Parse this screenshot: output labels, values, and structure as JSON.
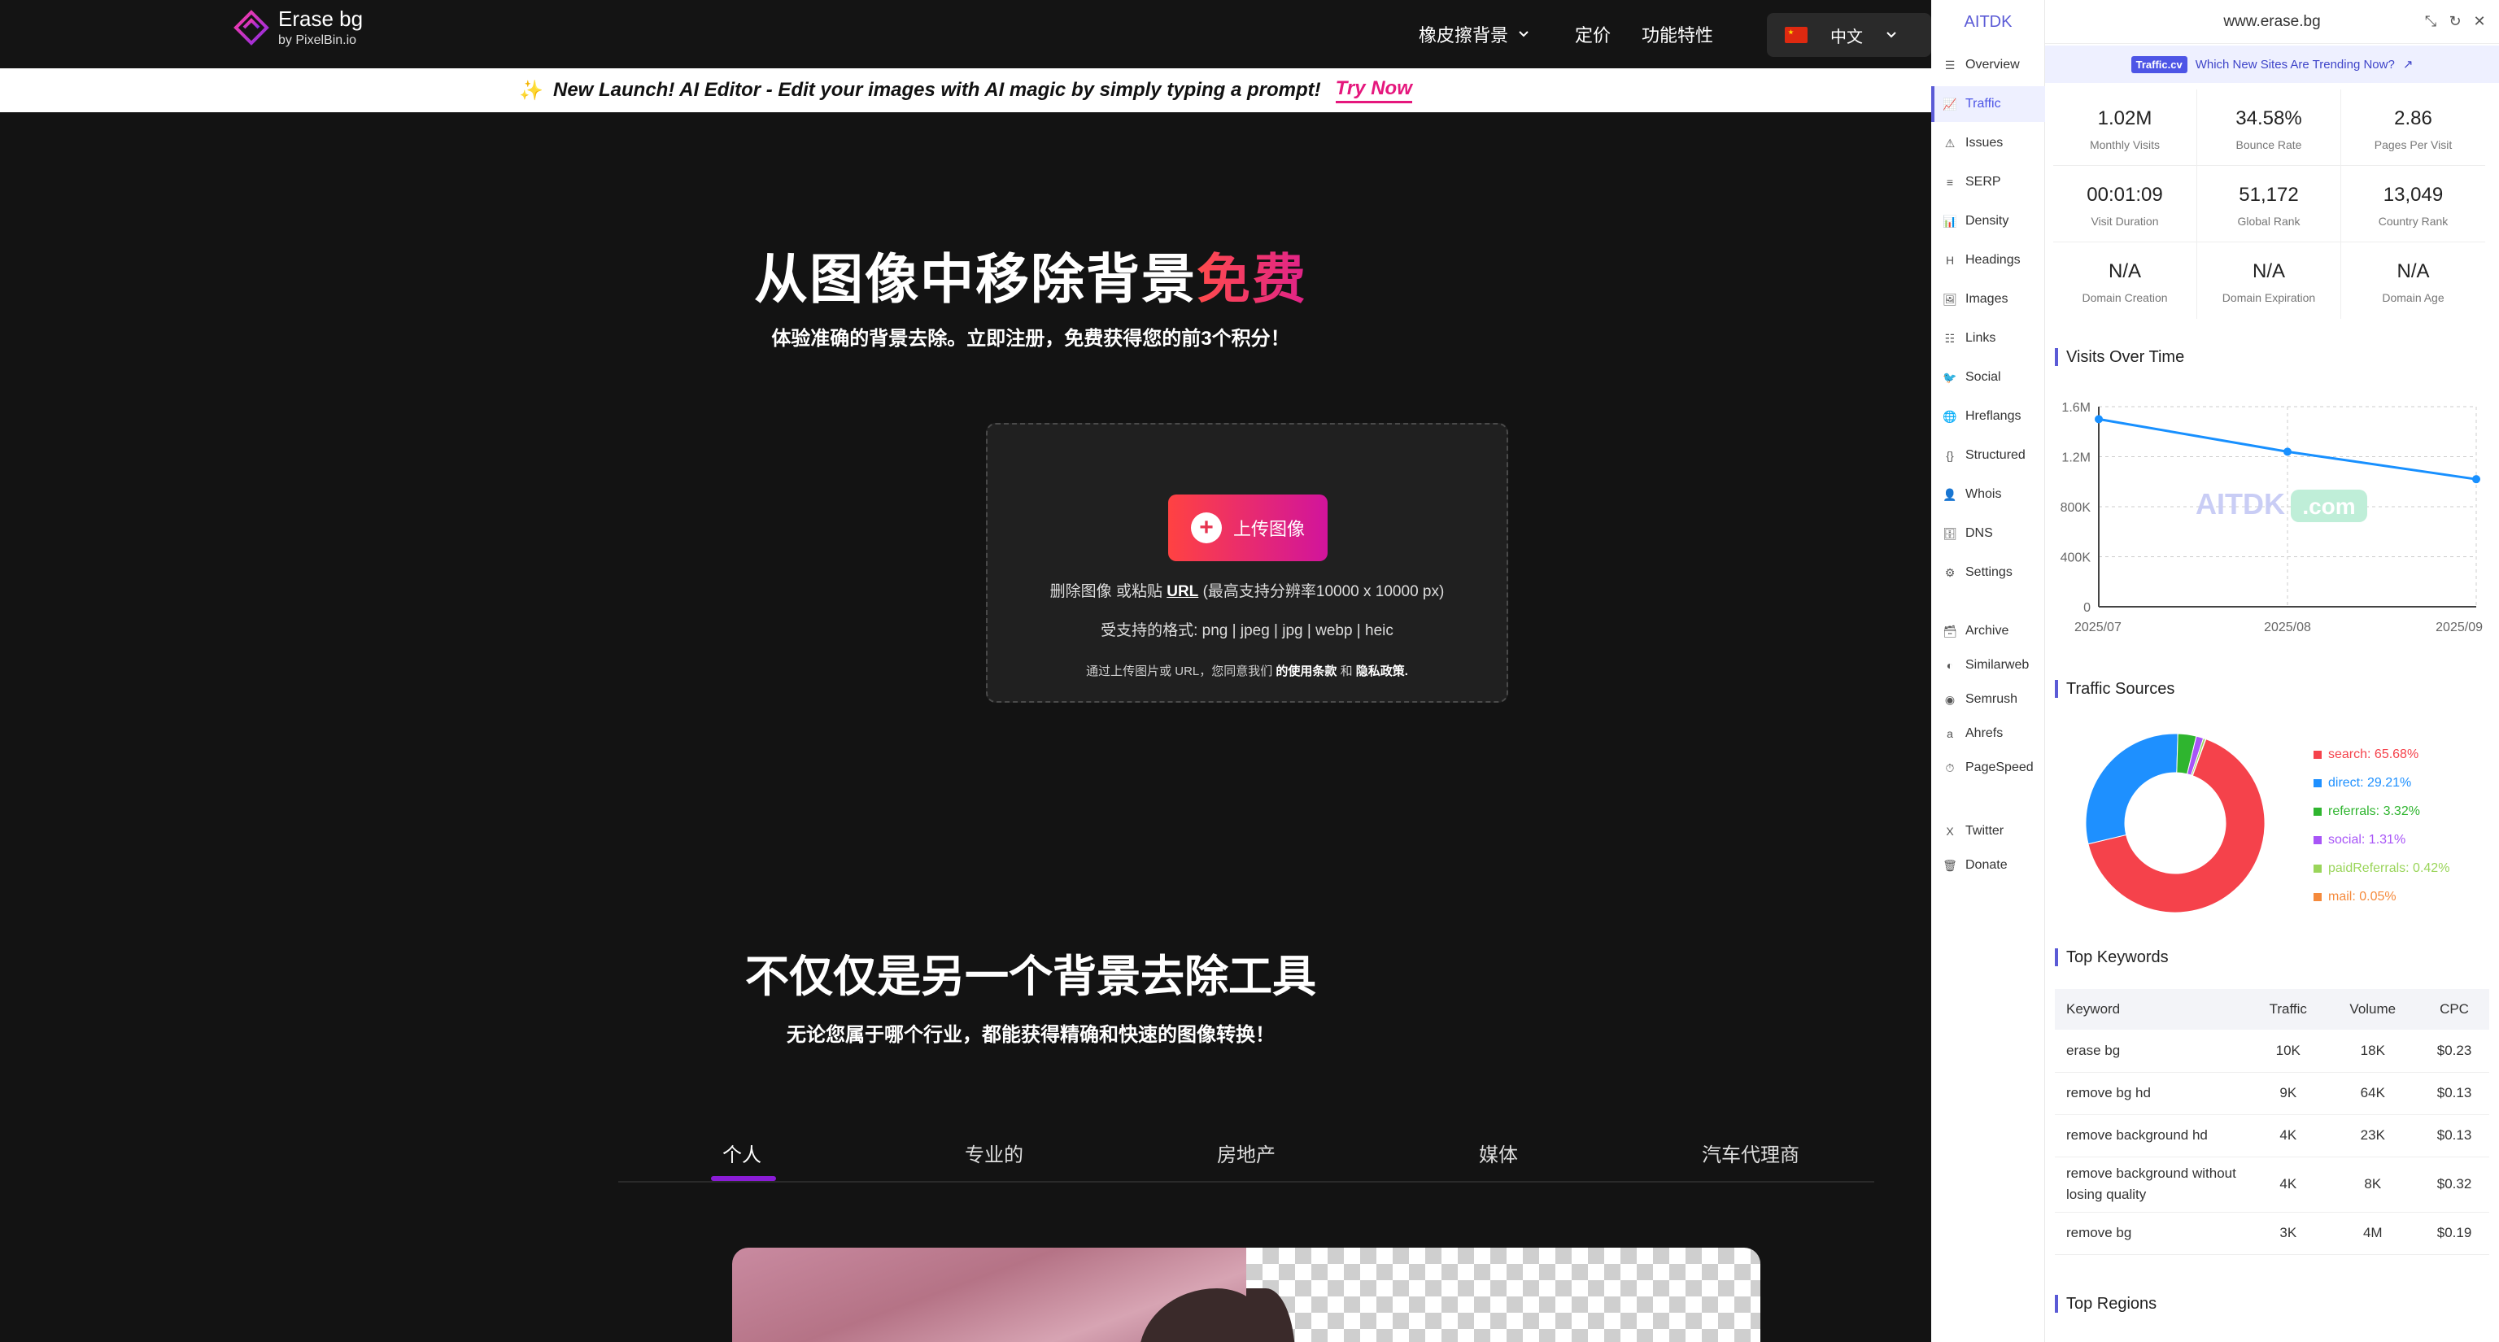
{
  "site": {
    "logo_title": "Erase bg",
    "logo_sub": "by PixelBin.io",
    "nav": [
      "橡皮擦背景",
      "定价",
      "功能特性"
    ],
    "language": "中文",
    "banner_text": "New Launch! AI Editor - Edit your images with AI magic by simply typing a prompt!",
    "banner_link": "Try Now",
    "hero_title_main": "从图像中移除背景",
    "hero_title_accent": "免费",
    "hero_subtitle": "体验准确的背景去除。立即注册，免费获得您的前3个积分！",
    "upload_button": "上传图像",
    "upload_line1_pre": "删除图像 或粘贴 ",
    "upload_line1_url": "URL",
    "upload_line1_post": " (最高支持分辨率10000 x 10000 px)",
    "upload_line2": "受支持的格式: png | jpeg | jpg | webp | heic",
    "upload_line3_pre": "通过上传图片或 URL，您同意我们 ",
    "upload_line3_terms": "的使用条款",
    "upload_line3_and": " 和 ",
    "upload_line3_privacy": "隐私政策.",
    "section_title": "不仅仅是另一个背景去除工具",
    "section_subtitle": "无论您属于哪个行业，都能获得精确和快速的图像转换！",
    "tabs": [
      "个人",
      "专业的",
      "房地产",
      "媒体",
      "汽车代理商"
    ]
  },
  "ext": {
    "brand": "AITDK",
    "domain": "www.erase.bg",
    "promo_tag": "Traffic.cv",
    "promo_text": "Which New Sites Are Trending Now?",
    "sidebar": [
      "Overview",
      "Traffic",
      "Issues",
      "SERP",
      "Density",
      "Headings",
      "Images",
      "Links",
      "Social",
      "Hreflangs",
      "Structured",
      "Whois",
      "DNS",
      "Settings"
    ],
    "sidebar_tools": [
      "Archive",
      "Similarweb",
      "Semrush",
      "Ahrefs",
      "PageSpeed"
    ],
    "sidebar_footer": [
      "Twitter",
      "Donate"
    ],
    "stats": [
      {
        "value": "1.02M",
        "label": "Monthly Visits"
      },
      {
        "value": "34.58%",
        "label": "Bounce Rate"
      },
      {
        "value": "2.86",
        "label": "Pages Per Visit"
      },
      {
        "value": "00:01:09",
        "label": "Visit Duration"
      },
      {
        "value": "51,172",
        "label": "Global Rank"
      },
      {
        "value": "13,049",
        "label": "Country Rank"
      },
      {
        "value": "N/A",
        "label": "Domain Creation"
      },
      {
        "value": "N/A",
        "label": "Domain Expiration"
      },
      {
        "value": "N/A",
        "label": "Domain Age"
      }
    ],
    "visits_title": "Visits Over Time",
    "watermark_a": "AITDK",
    "watermark_b": ".com",
    "sources_title": "Traffic Sources",
    "keywords_title": "Top Keywords",
    "keyword_headers": [
      "Keyword",
      "Traffic",
      "Volume",
      "CPC"
    ],
    "keywords": [
      [
        "erase bg",
        "10K",
        "18K",
        "$0.23"
      ],
      [
        "remove bg hd",
        "9K",
        "64K",
        "$0.13"
      ],
      [
        "remove background hd",
        "4K",
        "23K",
        "$0.13"
      ],
      [
        "remove background without losing quality",
        "4K",
        "8K",
        "$0.32"
      ],
      [
        "remove bg",
        "3K",
        "4M",
        "$0.19"
      ]
    ],
    "regions_title": "Top Regions"
  },
  "chart_data": [
    {
      "type": "line",
      "title": "Visits Over Time",
      "x": [
        "2025/07",
        "2025/08",
        "2025/09"
      ],
      "series": [
        {
          "values": [
            1500000,
            1240000,
            1020000
          ]
        }
      ],
      "y_ticks": [
        "0",
        "400K",
        "800K",
        "1.2M",
        "1.6M"
      ],
      "ylim": [
        0,
        1600000
      ],
      "grid": true,
      "color": "#1890ff"
    },
    {
      "type": "pie",
      "title": "Traffic Sources",
      "slices": [
        {
          "name": "search",
          "value": 65.68,
          "label": "search: 65.68%",
          "color": "#f5424b"
        },
        {
          "name": "direct",
          "value": 29.21,
          "label": "direct: 29.21%",
          "color": "#1e90ff"
        },
        {
          "name": "referrals",
          "value": 3.32,
          "label": "referrals: 3.32%",
          "color": "#2fb52f"
        },
        {
          "name": "social",
          "value": 1.31,
          "label": "social: 1.31%",
          "color": "#a855f7"
        },
        {
          "name": "paidReferrals",
          "value": 0.42,
          "label": "paidReferrals: 0.42%",
          "color": "#9ad55a"
        },
        {
          "name": "mail",
          "value": 0.05,
          "label": "mail: 0.05%",
          "color": "#f58a3c"
        }
      ],
      "legend": "right"
    }
  ]
}
